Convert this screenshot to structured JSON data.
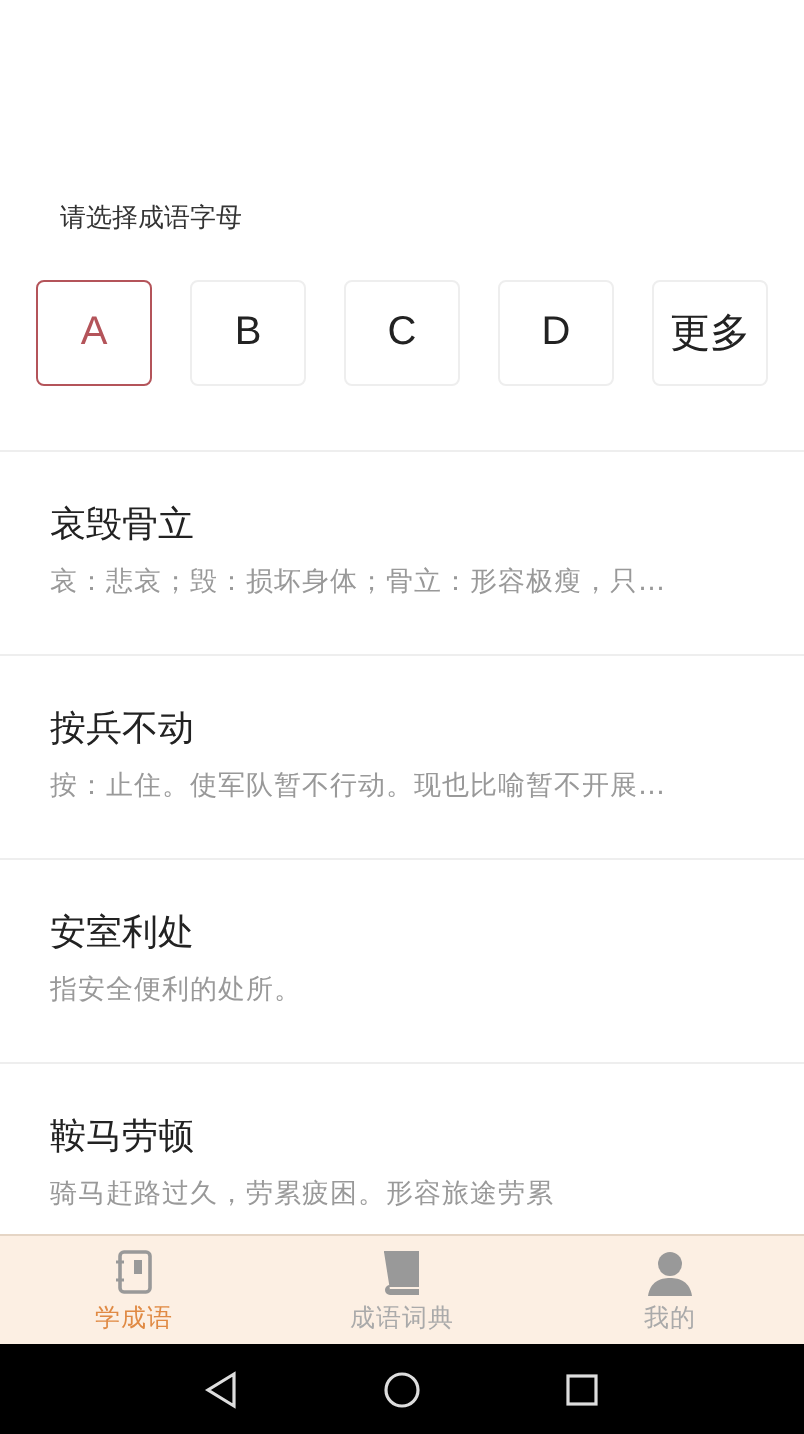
{
  "prompt": "请选择成语字母",
  "letters": [
    {
      "label": "A",
      "selected": true
    },
    {
      "label": "B",
      "selected": false
    },
    {
      "label": "C",
      "selected": false
    },
    {
      "label": "D",
      "selected": false
    },
    {
      "label": "更多",
      "selected": false
    }
  ],
  "idioms": [
    {
      "title": "哀毁骨立",
      "description": "哀：悲哀；毁：损坏身体；骨立：形容极瘦，只…"
    },
    {
      "title": "按兵不动",
      "description": "按：止住。使军队暂不行动。现也比喻暂不开展…"
    },
    {
      "title": "安室利处",
      "description": "指安全便利的处所。"
    },
    {
      "title": "鞍马劳顿",
      "description": "骑马赶路过久，劳累疲困。形容旅途劳累"
    }
  ],
  "tab_bar": [
    {
      "label": "学成语",
      "kind": "learn",
      "selected": true
    },
    {
      "label": "成语词典",
      "kind": "dictionary",
      "selected": false
    },
    {
      "label": "我的",
      "kind": "profile",
      "selected": false
    }
  ]
}
